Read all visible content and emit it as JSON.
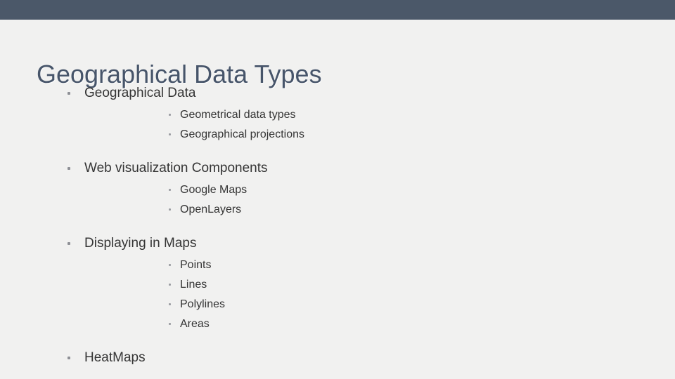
{
  "slide": {
    "title": "Geographical Data Types",
    "theme": {
      "background_color": "#f1f1f0",
      "top_bar_color": "#4b5869",
      "title_color": "#47556a",
      "body_text_color": "#353535",
      "bullet_color": "#8e9096"
    },
    "bullets": [
      {
        "label": "Geographical Data",
        "children": [
          {
            "label": "Geometrical data types"
          },
          {
            "label": "Geographical projections"
          }
        ]
      },
      {
        "label": "Web visualization Components",
        "children": [
          {
            "label": "Google Maps"
          },
          {
            "label": "OpenLayers"
          }
        ]
      },
      {
        "label": "Displaying in Maps",
        "children": [
          {
            "label": "Points"
          },
          {
            "label": "Lines"
          },
          {
            "label": "Polylines"
          },
          {
            "label": "Areas"
          }
        ]
      },
      {
        "label": "HeatMaps",
        "children": []
      }
    ]
  }
}
